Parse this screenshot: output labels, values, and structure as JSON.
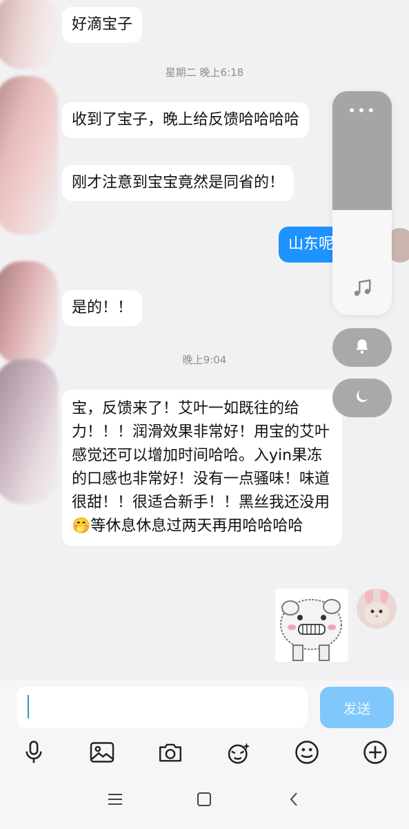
{
  "messages": [
    {
      "side": "left",
      "text": "好滴宝子"
    },
    {
      "side": "left",
      "text": "收到了宝子，晚上给反馈哈哈哈哈"
    },
    {
      "side": "left",
      "text": "刚才注意到宝宝竟然是同省的！"
    },
    {
      "side": "right",
      "text": "山东呢"
    },
    {
      "side": "left",
      "text": "是的！！"
    },
    {
      "side": "left",
      "text": "宝，反馈来了！艾叶一如既往的给力！！！润滑效果非常好！用宝的艾叶感觉还可以增加时间哈哈。入yin果冻的口感也非常好！没有一点骚味！味道很甜！！很适合新手！！黑丝我还没用🤭等休息休息过两天再用哈哈哈哈"
    }
  ],
  "timestamps": [
    "星期二 晚上6:18",
    "晚上9:04"
  ],
  "volume_overlay": {
    "menu_icon": "more-dots-icon",
    "level": 0.53,
    "stream_icon": "music-note-icon",
    "ring_icon": "bell-icon",
    "dnd_icon": "moon-icon"
  },
  "input": {
    "value": "",
    "send_label": "发送"
  },
  "toolbar": [
    "microphone-icon",
    "image-icon",
    "camera-icon",
    "emoji-sticker-icon",
    "smiley-icon",
    "plus-circle-icon"
  ],
  "navbar": [
    "menu-icon",
    "home-icon",
    "back-icon"
  ],
  "colors": {
    "background": "#f1f1f3",
    "bubble_me": "#1e92ff",
    "send_button": "#80c8fb"
  }
}
